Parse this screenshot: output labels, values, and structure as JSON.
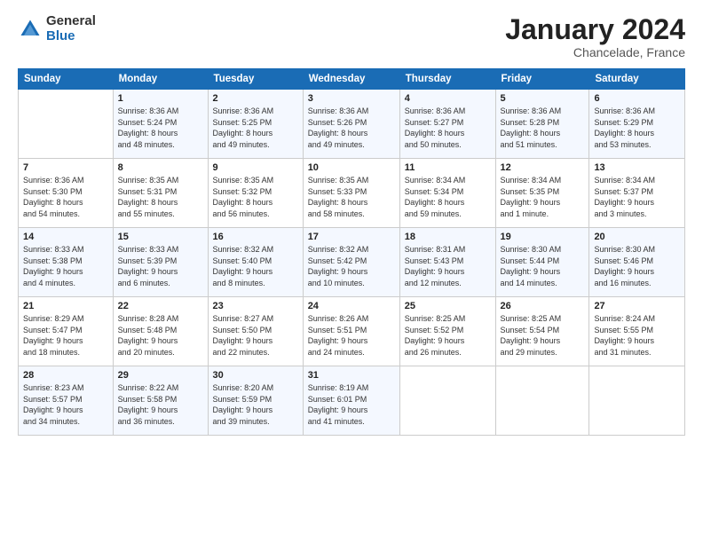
{
  "logo": {
    "general": "General",
    "blue": "Blue"
  },
  "header": {
    "month": "January 2024",
    "location": "Chancelade, France"
  },
  "days_header": [
    "Sunday",
    "Monday",
    "Tuesday",
    "Wednesday",
    "Thursday",
    "Friday",
    "Saturday"
  ],
  "weeks": [
    [
      {
        "day": "",
        "info": ""
      },
      {
        "day": "1",
        "info": "Sunrise: 8:36 AM\nSunset: 5:24 PM\nDaylight: 8 hours\nand 48 minutes."
      },
      {
        "day": "2",
        "info": "Sunrise: 8:36 AM\nSunset: 5:25 PM\nDaylight: 8 hours\nand 49 minutes."
      },
      {
        "day": "3",
        "info": "Sunrise: 8:36 AM\nSunset: 5:26 PM\nDaylight: 8 hours\nand 49 minutes."
      },
      {
        "day": "4",
        "info": "Sunrise: 8:36 AM\nSunset: 5:27 PM\nDaylight: 8 hours\nand 50 minutes."
      },
      {
        "day": "5",
        "info": "Sunrise: 8:36 AM\nSunset: 5:28 PM\nDaylight: 8 hours\nand 51 minutes."
      },
      {
        "day": "6",
        "info": "Sunrise: 8:36 AM\nSunset: 5:29 PM\nDaylight: 8 hours\nand 53 minutes."
      }
    ],
    [
      {
        "day": "7",
        "info": "Sunrise: 8:36 AM\nSunset: 5:30 PM\nDaylight: 8 hours\nand 54 minutes."
      },
      {
        "day": "8",
        "info": "Sunrise: 8:35 AM\nSunset: 5:31 PM\nDaylight: 8 hours\nand 55 minutes."
      },
      {
        "day": "9",
        "info": "Sunrise: 8:35 AM\nSunset: 5:32 PM\nDaylight: 8 hours\nand 56 minutes."
      },
      {
        "day": "10",
        "info": "Sunrise: 8:35 AM\nSunset: 5:33 PM\nDaylight: 8 hours\nand 58 minutes."
      },
      {
        "day": "11",
        "info": "Sunrise: 8:34 AM\nSunset: 5:34 PM\nDaylight: 8 hours\nand 59 minutes."
      },
      {
        "day": "12",
        "info": "Sunrise: 8:34 AM\nSunset: 5:35 PM\nDaylight: 9 hours\nand 1 minute."
      },
      {
        "day": "13",
        "info": "Sunrise: 8:34 AM\nSunset: 5:37 PM\nDaylight: 9 hours\nand 3 minutes."
      }
    ],
    [
      {
        "day": "14",
        "info": "Sunrise: 8:33 AM\nSunset: 5:38 PM\nDaylight: 9 hours\nand 4 minutes."
      },
      {
        "day": "15",
        "info": "Sunrise: 8:33 AM\nSunset: 5:39 PM\nDaylight: 9 hours\nand 6 minutes."
      },
      {
        "day": "16",
        "info": "Sunrise: 8:32 AM\nSunset: 5:40 PM\nDaylight: 9 hours\nand 8 minutes."
      },
      {
        "day": "17",
        "info": "Sunrise: 8:32 AM\nSunset: 5:42 PM\nDaylight: 9 hours\nand 10 minutes."
      },
      {
        "day": "18",
        "info": "Sunrise: 8:31 AM\nSunset: 5:43 PM\nDaylight: 9 hours\nand 12 minutes."
      },
      {
        "day": "19",
        "info": "Sunrise: 8:30 AM\nSunset: 5:44 PM\nDaylight: 9 hours\nand 14 minutes."
      },
      {
        "day": "20",
        "info": "Sunrise: 8:30 AM\nSunset: 5:46 PM\nDaylight: 9 hours\nand 16 minutes."
      }
    ],
    [
      {
        "day": "21",
        "info": "Sunrise: 8:29 AM\nSunset: 5:47 PM\nDaylight: 9 hours\nand 18 minutes."
      },
      {
        "day": "22",
        "info": "Sunrise: 8:28 AM\nSunset: 5:48 PM\nDaylight: 9 hours\nand 20 minutes."
      },
      {
        "day": "23",
        "info": "Sunrise: 8:27 AM\nSunset: 5:50 PM\nDaylight: 9 hours\nand 22 minutes."
      },
      {
        "day": "24",
        "info": "Sunrise: 8:26 AM\nSunset: 5:51 PM\nDaylight: 9 hours\nand 24 minutes."
      },
      {
        "day": "25",
        "info": "Sunrise: 8:25 AM\nSunset: 5:52 PM\nDaylight: 9 hours\nand 26 minutes."
      },
      {
        "day": "26",
        "info": "Sunrise: 8:25 AM\nSunset: 5:54 PM\nDaylight: 9 hours\nand 29 minutes."
      },
      {
        "day": "27",
        "info": "Sunrise: 8:24 AM\nSunset: 5:55 PM\nDaylight: 9 hours\nand 31 minutes."
      }
    ],
    [
      {
        "day": "28",
        "info": "Sunrise: 8:23 AM\nSunset: 5:57 PM\nDaylight: 9 hours\nand 34 minutes."
      },
      {
        "day": "29",
        "info": "Sunrise: 8:22 AM\nSunset: 5:58 PM\nDaylight: 9 hours\nand 36 minutes."
      },
      {
        "day": "30",
        "info": "Sunrise: 8:20 AM\nSunset: 5:59 PM\nDaylight: 9 hours\nand 39 minutes."
      },
      {
        "day": "31",
        "info": "Sunrise: 8:19 AM\nSunset: 6:01 PM\nDaylight: 9 hours\nand 41 minutes."
      },
      {
        "day": "",
        "info": ""
      },
      {
        "day": "",
        "info": ""
      },
      {
        "day": "",
        "info": ""
      }
    ]
  ]
}
